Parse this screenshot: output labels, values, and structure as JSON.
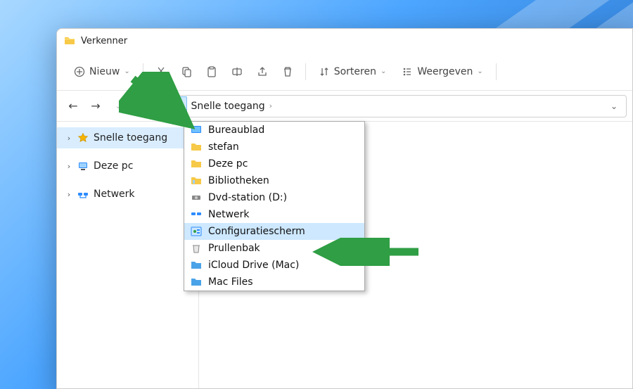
{
  "window": {
    "title": "Verkenner"
  },
  "toolbar": {
    "new_label": "Nieuw",
    "sort_label": "Sorteren",
    "view_label": "Weergeven"
  },
  "address": {
    "crumb": "Snelle toegang"
  },
  "sidebar": {
    "items": [
      {
        "label": "Snelle toegang"
      },
      {
        "label": "Deze pc"
      },
      {
        "label": "Netwerk"
      }
    ]
  },
  "dropdown": {
    "items": [
      {
        "label": "Bureaublad",
        "icon": "desktop"
      },
      {
        "label": "stefan",
        "icon": "folder"
      },
      {
        "label": "Deze pc",
        "icon": "folder"
      },
      {
        "label": "Bibliotheken",
        "icon": "libraries"
      },
      {
        "label": "Dvd-station (D:)",
        "icon": "dvd"
      },
      {
        "label": "Netwerk",
        "icon": "network"
      },
      {
        "label": "Configuratiescherm",
        "icon": "control-panel",
        "highlight": true
      },
      {
        "label": "Prullenbak",
        "icon": "recycle-bin"
      },
      {
        "label": "iCloud Drive (Mac)",
        "icon": "folder-blue"
      },
      {
        "label": "Mac Files",
        "icon": "folder-blue"
      }
    ]
  },
  "colors": {
    "highlight_bg": "#cde8ff",
    "arrow_green": "#2f9e44"
  }
}
